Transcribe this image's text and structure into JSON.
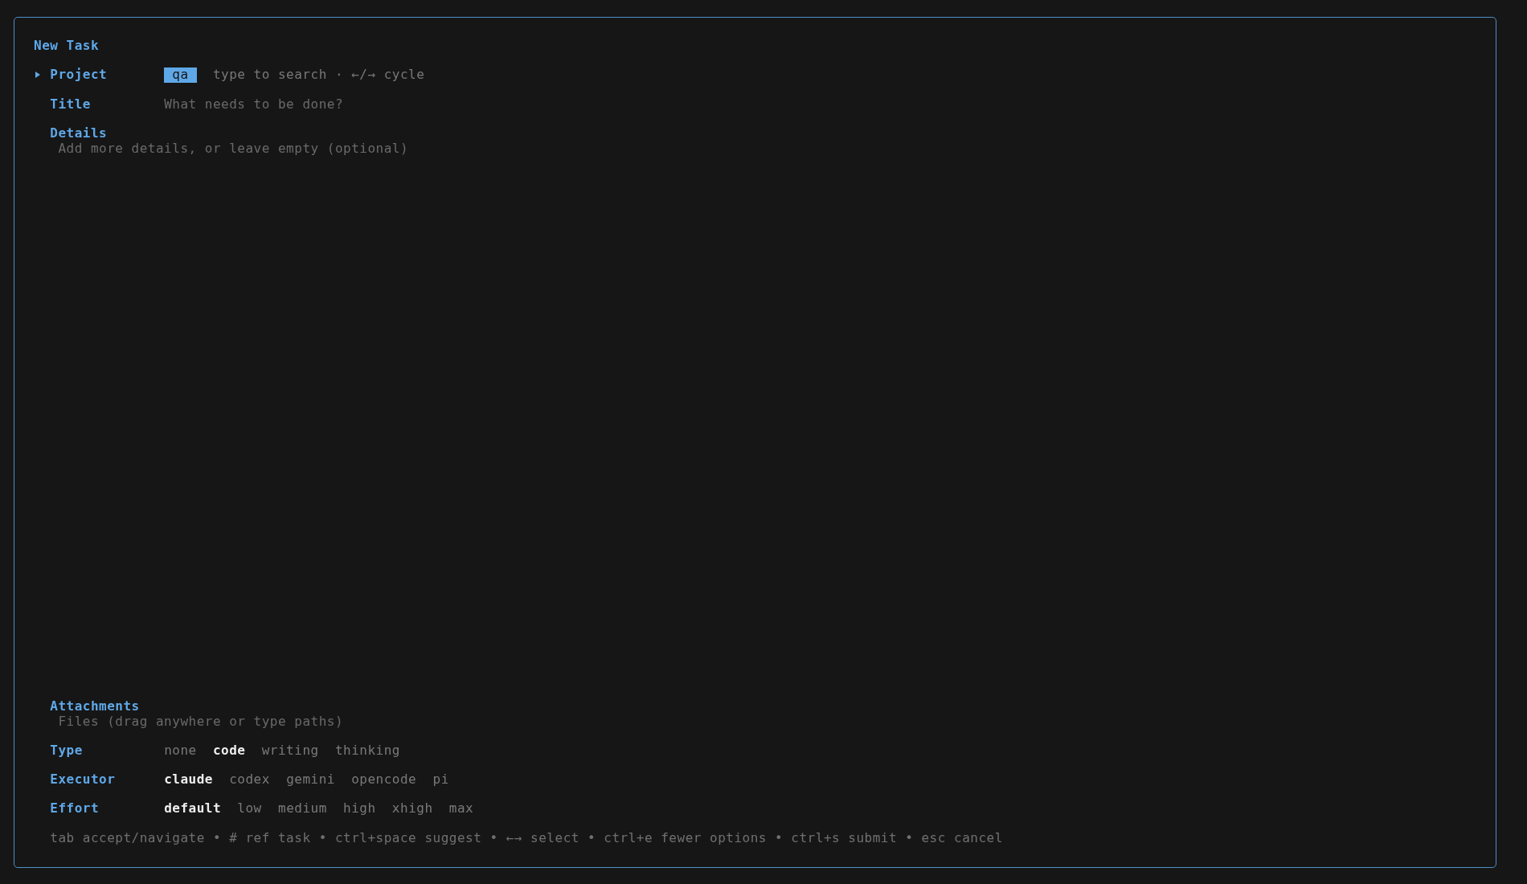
{
  "dialog": {
    "title": "New Task"
  },
  "fields": [
    {
      "kind": "select",
      "label": "Project",
      "focused": true,
      "value": "qa",
      "hint": "type to search · ←/→ cycle"
    },
    {
      "kind": "text",
      "label": "Title",
      "focused": false,
      "placeholder": "What needs to be done?"
    },
    {
      "kind": "textarea",
      "label": "Details",
      "focused": false,
      "placeholder": "Add more details, or leave empty (optional)"
    },
    {
      "kind": "files",
      "label": "Attachments",
      "focused": false,
      "placeholder": "Files (drag anywhere or type paths)"
    },
    {
      "kind": "choice",
      "label": "Type",
      "focused": false,
      "options": [
        {
          "label": "none",
          "selected": false
        },
        {
          "label": "code",
          "selected": true
        },
        {
          "label": "writing",
          "selected": false
        },
        {
          "label": "thinking",
          "selected": false
        }
      ]
    },
    {
      "kind": "choice",
      "label": "Executor",
      "focused": false,
      "options": [
        {
          "label": "claude",
          "selected": true
        },
        {
          "label": "codex",
          "selected": false
        },
        {
          "label": "gemini",
          "selected": false
        },
        {
          "label": "opencode",
          "selected": false
        },
        {
          "label": "pi",
          "selected": false
        }
      ]
    },
    {
      "kind": "choice",
      "label": "Effort",
      "focused": false,
      "options": [
        {
          "label": "default",
          "selected": true
        },
        {
          "label": "low",
          "selected": false
        },
        {
          "label": "medium",
          "selected": false
        },
        {
          "label": "high",
          "selected": false
        },
        {
          "label": "xhigh",
          "selected": false
        },
        {
          "label": "max",
          "selected": false
        }
      ]
    }
  ],
  "help": "tab accept/navigate • # ref task • ctrl+space suggest • ←→ select • ctrl+e fewer options • ctrl+s submit • esc cancel"
}
